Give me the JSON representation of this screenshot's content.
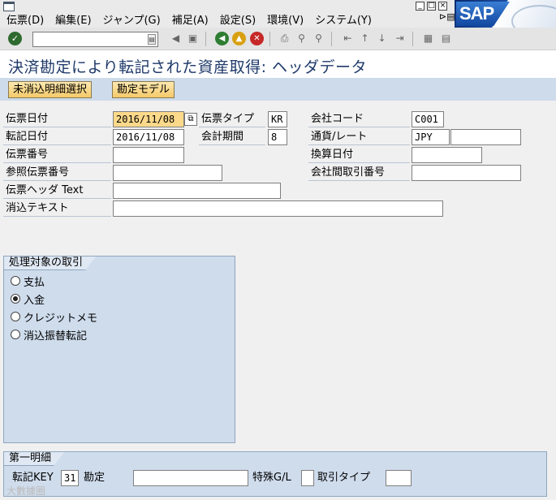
{
  "menu": {
    "items": [
      "伝票(D)",
      "編集(E)",
      "ジャンプ(G)",
      "補足(A)",
      "設定(S)",
      "環境(V)",
      "システム(Y)"
    ]
  },
  "logo": {
    "text": "SAP"
  },
  "title": "決済勘定により転記された資産取得: ヘッダデータ",
  "app_toolbar": {
    "btn1": "未消込明細選択",
    "btn2": "勘定モデル"
  },
  "header": {
    "doc_date_label": "伝票日付",
    "doc_date_value": "2016/11/08",
    "doc_type_label": "伝票タイプ",
    "doc_type_value": "KR",
    "company_code_label": "会社コード",
    "company_code_value": "C001",
    "posting_date_label": "転記日付",
    "posting_date_value": "2016/11/08",
    "period_label": "会計期間",
    "period_value": "8",
    "currency_label": "通貨/レート",
    "currency_value": "JPY",
    "rate_value": "",
    "doc_number_label": "伝票番号",
    "doc_number_value": "",
    "translation_date_label": "換算日付",
    "translation_date_value": "",
    "reference_label": "参照伝票番号",
    "reference_value": "",
    "intercompany_label": "会社間取引番号",
    "intercompany_value": "",
    "header_text_label": "伝票ヘッダ Text",
    "header_text_value": "",
    "clearing_text_label": "消込テキスト",
    "clearing_text_value": ""
  },
  "transaction_group": {
    "title": "処理対象の取引",
    "options": [
      {
        "label": "支払",
        "selected": false
      },
      {
        "label": "入金",
        "selected": true
      },
      {
        "label": "クレジットメモ",
        "selected": false
      },
      {
        "label": "消込振替転記",
        "selected": false
      }
    ]
  },
  "first_item": {
    "title": "第一明細",
    "posting_key_label": "転記KEY",
    "posting_key_value": "31",
    "account_label": "勘定",
    "account_value": "",
    "special_gl_label": "特殊G/L",
    "special_gl_value": "",
    "trans_type_label": "取引タイプ",
    "trans_type_value": ""
  },
  "watermark": "大數據圈",
  "colors": {
    "title": "#1f3a6a",
    "required_field": "#fcd98a",
    "group_bg": "#cfdcec"
  }
}
